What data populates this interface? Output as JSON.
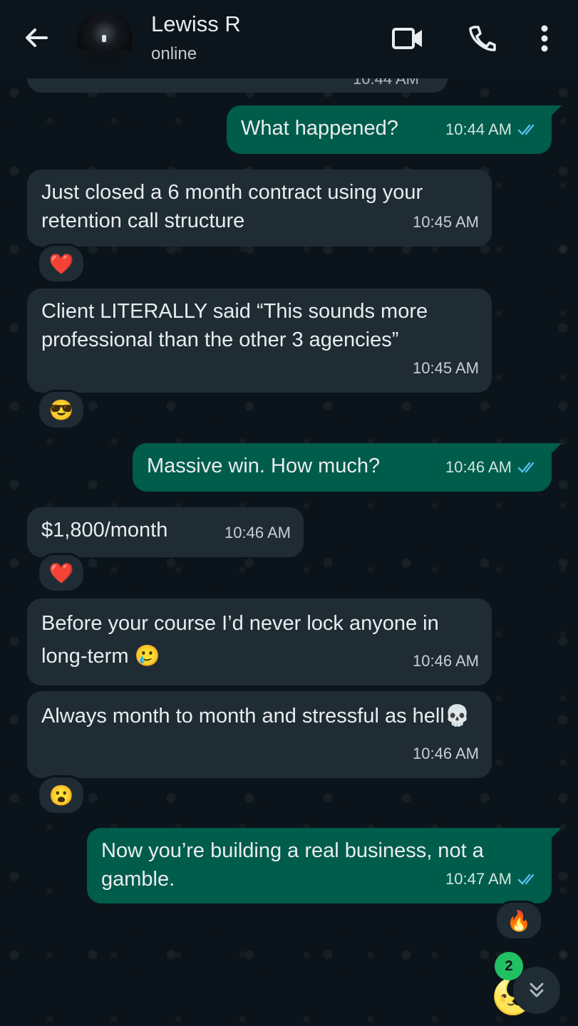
{
  "header": {
    "contact_name": "Lewiss R",
    "status": "online",
    "icons": [
      "back-arrow-icon",
      "video-call-icon",
      "voice-call-icon",
      "more-options-icon"
    ]
  },
  "chat": {
    "partial_time": "10:44 AM",
    "messages": [
      {
        "dir": "out",
        "text": "What happened?",
        "time": "10:44 AM",
        "ticks": "read"
      },
      {
        "dir": "in",
        "text": "Just closed a 6 month contract using your retention call structure",
        "time": "10:45 AM",
        "reaction": "❤️"
      },
      {
        "dir": "in",
        "text": "Client LITERALLY said “This sounds more professional than the other 3 agencies”",
        "time": "10:45 AM",
        "reaction": "😎"
      },
      {
        "dir": "out",
        "text": "Massive win. How much?",
        "time": "10:46 AM",
        "ticks": "read"
      },
      {
        "dir": "in",
        "text": "$1,800/month",
        "time": "10:46 AM",
        "reaction": "❤️"
      },
      {
        "dir": "in",
        "text": "Before your course I’d never lock anyone in long-term 🥲",
        "time": "10:46 AM"
      },
      {
        "dir": "in",
        "text": "Always month to month and stressful as hell💀",
        "time": "10:46 AM",
        "reaction": "😮"
      },
      {
        "dir": "out",
        "text": "Now you’re building a real business, not a gamble.",
        "time": "10:47 AM",
        "ticks": "read",
        "reaction": "🔥"
      }
    ],
    "unread_count": "2",
    "floating_emoji": "🌜"
  },
  "colors": {
    "background": "#0b141a",
    "incoming_bubble": "#1f2c34",
    "outgoing_bubble": "#005c4b",
    "read_ticks": "#53bdeb",
    "unread_badge": "#21c063"
  }
}
